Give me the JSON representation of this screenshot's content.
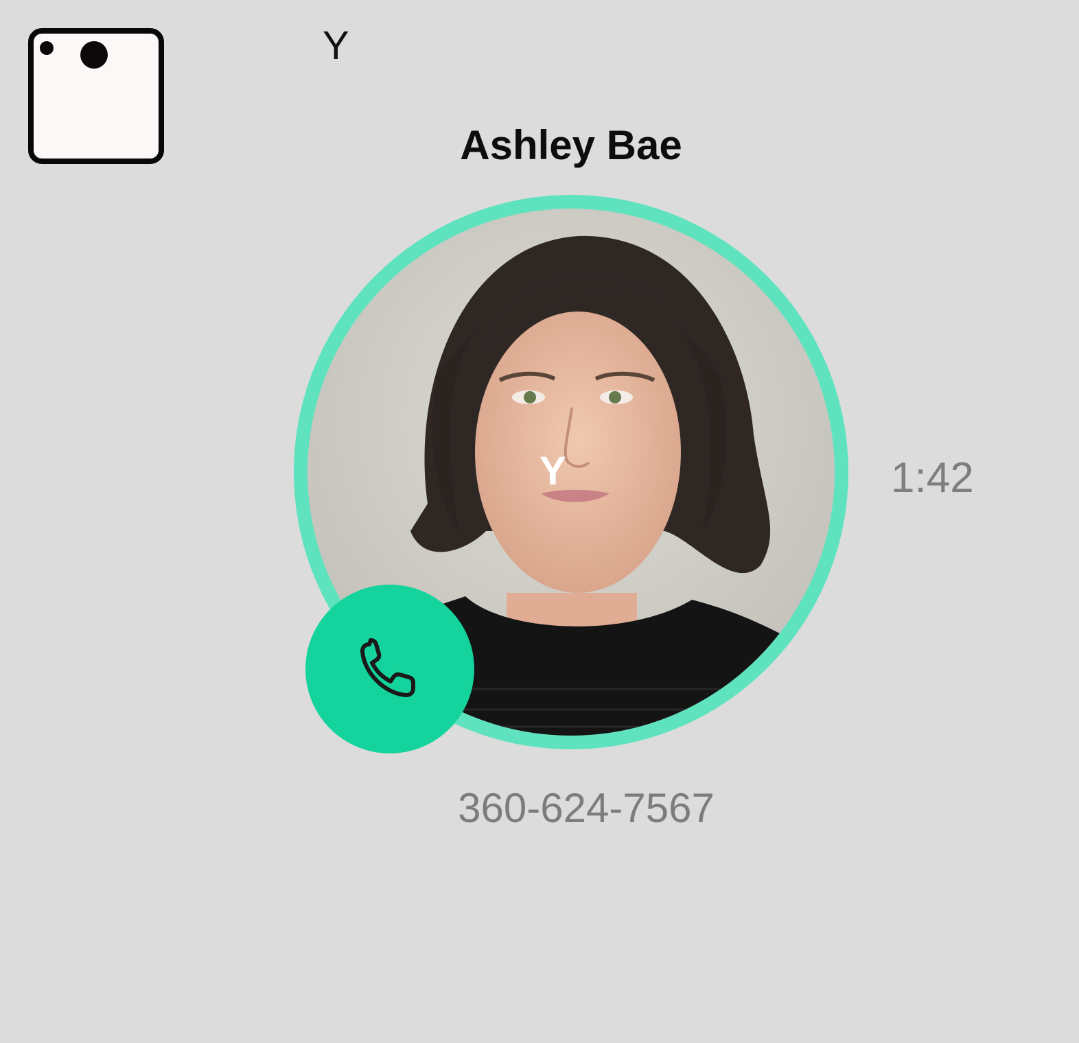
{
  "top_bar": {
    "app_icon": "app-window-icon",
    "glyph": "Y"
  },
  "call": {
    "caller_name": "Ashley Bae",
    "avatar_glyph": "Y",
    "duration": "1:42",
    "phone_number": "360-624-7567",
    "call_button_icon": "phone-icon"
  },
  "colors": {
    "background": "#dcdcdc",
    "ring": "#5fe3bf",
    "call_button": "#15d39c",
    "secondary_text": "#7e7e7e"
  }
}
